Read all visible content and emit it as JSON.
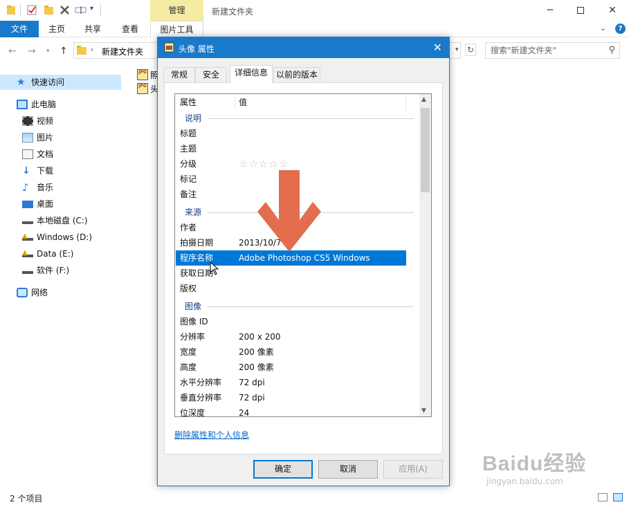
{
  "explorer": {
    "title": "新建文件夹",
    "contextual_tab_group": "管理",
    "ribbon_tabs": [
      "文件",
      "主页",
      "共享",
      "查看",
      "图片工具"
    ],
    "address_path": "新建文件夹",
    "search_placeholder": "搜索\"新建文件夹\"",
    "sidebar": {
      "quick_access": "快速访问",
      "this_pc": "此电脑",
      "items": [
        "视频",
        "图片",
        "文档",
        "下载",
        "音乐",
        "桌面",
        "本地磁盘 (C:)",
        "Windows (D:)",
        "Data (E:)",
        "软件 (F:)"
      ],
      "network": "网络"
    },
    "files": [
      "照",
      "头"
    ],
    "status": "2 个项目"
  },
  "dialog": {
    "title": "头像 属性",
    "tabs": [
      "常规",
      "安全",
      "详细信息",
      "以前的版本"
    ],
    "columns": {
      "property": "属性",
      "value": "值"
    },
    "groups": {
      "description": "说明",
      "origin": "来源",
      "image": "图像"
    },
    "rows_description": [
      {
        "k": "标题",
        "v": ""
      },
      {
        "k": "主题",
        "v": ""
      },
      {
        "k": "分级",
        "v": "☆☆☆☆☆"
      },
      {
        "k": "标记",
        "v": ""
      },
      {
        "k": "备注",
        "v": ""
      }
    ],
    "rows_origin": [
      {
        "k": "作者",
        "v": ""
      },
      {
        "k": "拍摄日期",
        "v": "2013/10/7"
      },
      {
        "k": "程序名称",
        "v": "Adobe Photoshop CS5 Windows"
      },
      {
        "k": "获取日期",
        "v": ""
      },
      {
        "k": "版权",
        "v": ""
      }
    ],
    "rows_image": [
      {
        "k": "图像 ID",
        "v": ""
      },
      {
        "k": "分辨率",
        "v": "200 x 200"
      },
      {
        "k": "宽度",
        "v": "200 像素"
      },
      {
        "k": "高度",
        "v": "200 像素"
      },
      {
        "k": "水平分辨率",
        "v": "72 dpi"
      },
      {
        "k": "垂直分辨率",
        "v": "72 dpi"
      },
      {
        "k": "位深度",
        "v": "24"
      }
    ],
    "remove_link": "删除属性和个人信息",
    "buttons": {
      "ok": "确定",
      "cancel": "取消",
      "apply": "应用(A)"
    }
  },
  "watermark": {
    "brand": "Baidu经验",
    "url": "jingyan.baidu.com"
  },
  "colors": {
    "accent": "#1979ca",
    "selection": "#0078d7",
    "tools_tab": "#f5eba2",
    "annotation_arrow": "#e0623f"
  }
}
